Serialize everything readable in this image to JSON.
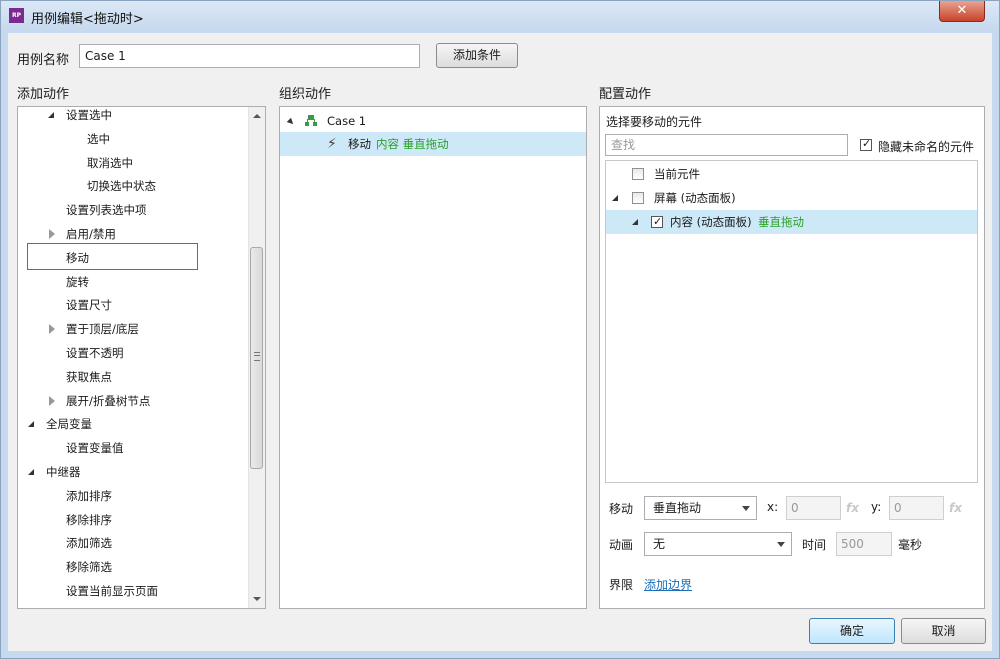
{
  "window": {
    "title": "用例编辑<拖动时>",
    "icon_text": "RP",
    "close": "✕"
  },
  "case_name": {
    "label": "用例名称",
    "value": "Case 1",
    "add_condition": "添加条件"
  },
  "add_actions": {
    "heading": "添加动作",
    "items": [
      {
        "label": "设置选中",
        "level": 1,
        "expander": "open"
      },
      {
        "label": "选中",
        "level": 2
      },
      {
        "label": "取消选中",
        "level": 2
      },
      {
        "label": "切换选中状态",
        "level": 2
      },
      {
        "label": "设置列表选中项",
        "level": 1
      },
      {
        "label": "启用/禁用",
        "level": 1,
        "expander": "closed"
      },
      {
        "label": "移动",
        "level": 1,
        "highlighted": true
      },
      {
        "label": "旋转",
        "level": 1
      },
      {
        "label": "设置尺寸",
        "level": 1
      },
      {
        "label": "置于顶层/底层",
        "level": 1,
        "expander": "closed"
      },
      {
        "label": "设置不透明",
        "level": 1
      },
      {
        "label": "获取焦点",
        "level": 1
      },
      {
        "label": "展开/折叠树节点",
        "level": 1,
        "expander": "closed"
      },
      {
        "label": "全局变量",
        "level": 0,
        "expander": "open"
      },
      {
        "label": "设置变量值",
        "level": 1
      },
      {
        "label": "中继器",
        "level": 0,
        "expander": "open"
      },
      {
        "label": "添加排序",
        "level": 1
      },
      {
        "label": "移除排序",
        "level": 1
      },
      {
        "label": "添加筛选",
        "level": 1
      },
      {
        "label": "移除筛选",
        "level": 1
      },
      {
        "label": "设置当前显示页面",
        "level": 1
      }
    ]
  },
  "organize_actions": {
    "heading": "组织动作",
    "case_label": "Case 1",
    "action_prefix": "移动",
    "action_target": "内容 垂直拖动"
  },
  "configure_actions": {
    "heading": "配置动作",
    "select_label": "选择要移动的元件",
    "search_placeholder": "查找",
    "hide_unnamed": "隐藏未命名的元件",
    "widgets": [
      {
        "label": "当前元件",
        "checked": false
      },
      {
        "label": "屏幕 (动态面板)",
        "checked": false
      },
      {
        "label": "内容 (动态面板)",
        "suffix": "垂直拖动",
        "checked": true
      }
    ],
    "move_label": "移动",
    "move_value": "垂直拖动",
    "x_label": "x:",
    "x_value": "0",
    "y_label": "y:",
    "y_value": "0",
    "fx": "fx",
    "anim_label": "动画",
    "anim_value": "无",
    "time_label": "时间",
    "time_value": "500",
    "ms_label": "毫秒",
    "bounds_label": "界限",
    "bounds_link": "添加边界"
  },
  "footer": {
    "ok": "确定",
    "cancel": "取消"
  }
}
